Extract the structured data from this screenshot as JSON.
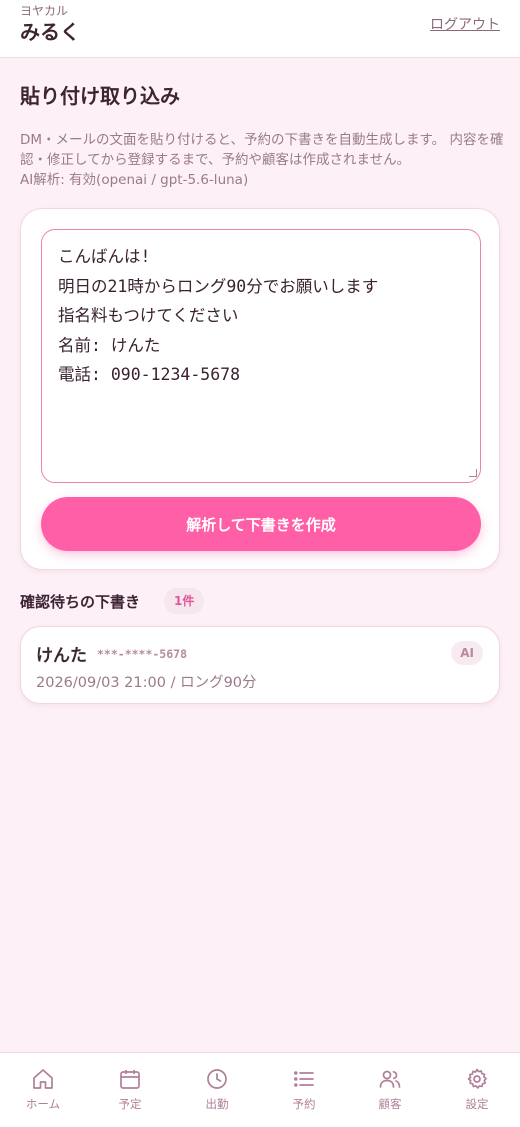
{
  "header": {
    "shop_name": "ヨヤカル",
    "user_name": "みるく",
    "logout_label": "ログアウト"
  },
  "page": {
    "title": "貼り付け取り込み",
    "description": "DM・メールの文面を貼り付けると、予約の下書きを自動生成します。 内容を確認・修正してから登録するまで、予約や顧客は作成されません。",
    "ai_status": "AI解析: 有効(openai / gpt-5.6-luna)"
  },
  "input": {
    "value": "こんばんは!\n明日の21時からロング90分でお願いします\n指名料もつけてください\n名前: けんた\n電話: 090-1234-5678"
  },
  "actions": {
    "parse_button_label": "解析して下書きを作成"
  },
  "drafts": {
    "section_title": "確認待ちの下書き",
    "count_label": "1件",
    "items": [
      {
        "name": "けんた",
        "phone": "***-****-5678",
        "badge": "AI",
        "meta": "2026/09/03 21:00 / ロング90分"
      }
    ]
  },
  "nav": {
    "items": [
      {
        "label": "ホーム",
        "icon": "home-icon"
      },
      {
        "label": "予定",
        "icon": "calendar-icon"
      },
      {
        "label": "出勤",
        "icon": "clock-icon"
      },
      {
        "label": "予約",
        "icon": "list-icon"
      },
      {
        "label": "顧客",
        "icon": "users-icon"
      },
      {
        "label": "設定",
        "icon": "gear-icon"
      }
    ]
  },
  "colors": {
    "background": "#fdf1f7",
    "accent": "#ff5fa6",
    "nav_icon": "#b07f99"
  }
}
